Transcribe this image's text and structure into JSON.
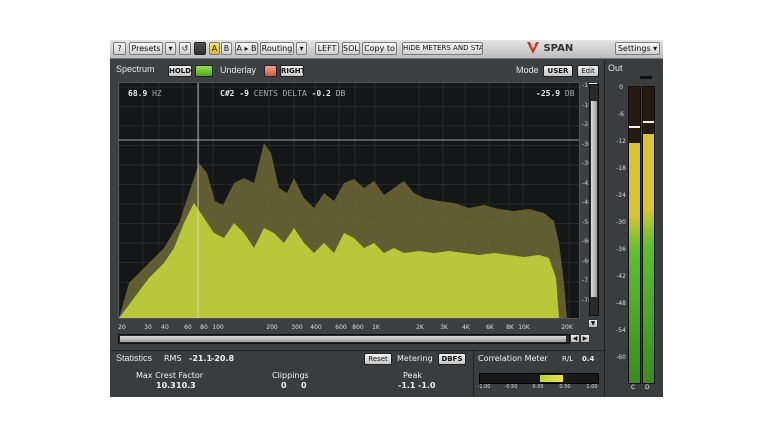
{
  "toolbar": {
    "help": "?",
    "presets": "Presets",
    "dropdown_arrow": "▾",
    "undo": "↺",
    "ab_a": "A",
    "ab_b": "B",
    "ab_copy": "A ▸ B",
    "routing": "Routing",
    "left": "LEFT",
    "solo": "SOLO",
    "copy_to": "Copy to",
    "hide_meters": "HIDE METERS AND STATS",
    "logo_text": "SPAN",
    "settings": "Settings ▾"
  },
  "spectrum": {
    "label": "Spectrum",
    "hold": "HOLD",
    "underlay": "Underlay",
    "right": "RIGHT",
    "mode_label": "Mode",
    "mode_value": "USER",
    "edit": "Edit",
    "readout_freq": "68.9",
    "readout_freq_unit": "HZ",
    "readout_note": "C#2",
    "readout_cents": "-9",
    "readout_cents_unit": "CENTS",
    "readout_delta_label": "DELTA",
    "readout_delta": "-0.2",
    "readout_delta_unit": "DB",
    "readout_level": "-25.9",
    "readout_level_unit": "DB",
    "db_ticks": [
      "-12",
      "-18",
      "-24",
      "-30",
      "-36",
      "-42",
      "-48",
      "-54",
      "-60",
      "-66",
      "-72",
      "-78"
    ],
    "freq_ticks": [
      "20",
      "30",
      "40",
      "60",
      "80",
      "100",
      "200",
      "300",
      "400",
      "600",
      "800",
      "1K",
      "2K",
      "3K",
      "4K",
      "6K",
      "8K",
      "10K",
      "20K"
    ]
  },
  "output": {
    "label": "Out",
    "ticks": [
      "0",
      "-6",
      "-12",
      "-18",
      "-24",
      "-30",
      "-36",
      "-42",
      "-48",
      "-54",
      "-60"
    ],
    "left_level": 0.81,
    "right_level": 0.84,
    "left_peak": 0.86,
    "right_peak": 0.88,
    "channel_left": "C",
    "channel_right": "D"
  },
  "stats": {
    "label": "Statistics",
    "rms_label": "RMS",
    "rms_left": "-21.1",
    "rms_right": "-20.8",
    "reset": "Reset",
    "metering_label": "Metering",
    "metering_value": "DBFS",
    "max_crest_label": "Max Crest Factor",
    "max_crest_left": "10.3",
    "max_crest_right": "10.3",
    "clippings_label": "Clippings",
    "clippings_left": "0",
    "clippings_right": "0",
    "peak_label": "Peak",
    "peak_left": "-1.1",
    "peak_right": "-1.0"
  },
  "correlation": {
    "label": "Correlation Meter",
    "rl_label": "R/L",
    "rl_value": "0.4",
    "level": 0.4,
    "ticks": [
      "-1.00",
      "-0.50",
      "0.00",
      "0.50",
      "1.00"
    ]
  },
  "colors": {
    "spectrum_fill": "#b9c83a",
    "spectrum_back": "#8f8f3a",
    "hold_on": "#6cc430",
    "right_on": "#e2765d",
    "meter_green": "#5ec12a",
    "meter_yellow": "#d8c430"
  }
}
